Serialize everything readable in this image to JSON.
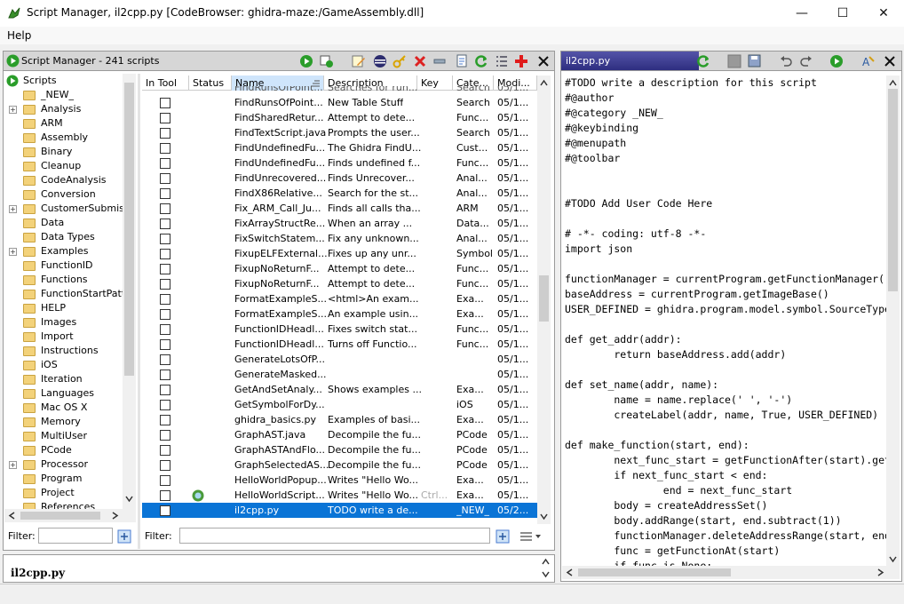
{
  "window": {
    "title": "Script Manager, il2cpp.py [CodeBrowser: ghidra-maze:/GameAssembly.dll]",
    "minimize": "—",
    "maximize": "☐",
    "close": "✕"
  },
  "menu": {
    "help": "Help"
  },
  "script_manager": {
    "header": "Script Manager - 241 scripts",
    "tree_root": "Scripts",
    "tree": [
      {
        "label": "_NEW_",
        "expandable": false
      },
      {
        "label": "Analysis",
        "expandable": true
      },
      {
        "label": "ARM",
        "expandable": false
      },
      {
        "label": "Assembly",
        "expandable": false
      },
      {
        "label": "Binary",
        "expandable": false
      },
      {
        "label": "Cleanup",
        "expandable": false
      },
      {
        "label": "CodeAnalysis",
        "expandable": false
      },
      {
        "label": "Conversion",
        "expandable": false
      },
      {
        "label": "CustomerSubmissio",
        "expandable": true
      },
      {
        "label": "Data",
        "expandable": false
      },
      {
        "label": "Data Types",
        "expandable": false
      },
      {
        "label": "Examples",
        "expandable": true
      },
      {
        "label": "FunctionID",
        "expandable": false
      },
      {
        "label": "Functions",
        "expandable": false
      },
      {
        "label": "FunctionStartPatte",
        "expandable": false
      },
      {
        "label": "HELP",
        "expandable": false
      },
      {
        "label": "Images",
        "expandable": false
      },
      {
        "label": "Import",
        "expandable": false
      },
      {
        "label": "Instructions",
        "expandable": false
      },
      {
        "label": "iOS",
        "expandable": false
      },
      {
        "label": "Iteration",
        "expandable": false
      },
      {
        "label": "Languages",
        "expandable": false
      },
      {
        "label": "Mac OS X",
        "expandable": false
      },
      {
        "label": "Memory",
        "expandable": false
      },
      {
        "label": "MultiUser",
        "expandable": false
      },
      {
        "label": "PCode",
        "expandable": false
      },
      {
        "label": "Processor",
        "expandable": true
      },
      {
        "label": "Program",
        "expandable": false
      },
      {
        "label": "Project",
        "expandable": false
      },
      {
        "label": "References",
        "expandable": false
      }
    ],
    "columns": {
      "in_tool": "In Tool",
      "status": "Status",
      "name": "Name",
      "description": "Description",
      "key": "Key",
      "category": "Cate...",
      "modified": "Modi..."
    },
    "partial_row": {
      "name": "FindRunsOfPoint...",
      "description": "Searches for run...",
      "category": "Search",
      "modified": "05/1..."
    },
    "rows": [
      {
        "name": "FindRunsOfPoint...",
        "description": "New Table Stuff",
        "key": "",
        "category": "Search",
        "modified": "05/1..."
      },
      {
        "name": "FindSharedRetur...",
        "description": " Attempt to dete...",
        "key": "",
        "category": "Func...",
        "modified": "05/1..."
      },
      {
        "name": "FindTextScript.java",
        "description": "Prompts the user...",
        "key": "",
        "category": "Search",
        "modified": "05/1..."
      },
      {
        "name": "FindUndefinedFu...",
        "description": "The Ghidra FindU...",
        "key": "",
        "category": "Cust...",
        "modified": "05/1..."
      },
      {
        "name": "FindUndefinedFu...",
        "description": "Finds undefined f...",
        "key": "",
        "category": "Func...",
        "modified": "05/1..."
      },
      {
        "name": "FindUnrecovered...",
        "description": "Finds Unrecover...",
        "key": "",
        "category": "Anal...",
        "modified": "05/1..."
      },
      {
        "name": "FindX86Relative...",
        "description": "Search for the st...",
        "key": "",
        "category": "Anal...",
        "modified": "05/1..."
      },
      {
        "name": "Fix_ARM_Call_Ju...",
        "description": "Finds all calls tha...",
        "key": "",
        "category": "ARM",
        "modified": "05/1..."
      },
      {
        "name": "FixArrayStructRe...",
        "description": " When an array ...",
        "key": "",
        "category": "Data...",
        "modified": "05/1..."
      },
      {
        "name": "FixSwitchStatem...",
        "description": "Fix any unknown...",
        "key": "",
        "category": "Anal...",
        "modified": "05/1..."
      },
      {
        "name": "FixupELFExternal...",
        "description": "Fixes up any unr...",
        "key": "",
        "category": "Symbol",
        "modified": "05/1..."
      },
      {
        "name": "FixupNoReturnF...",
        "description": " Attempt to dete...",
        "key": "",
        "category": "Func...",
        "modified": "05/1..."
      },
      {
        "name": "FixupNoReturnF...",
        "description": " Attempt to dete...",
        "key": "",
        "category": "Func...",
        "modified": "05/1..."
      },
      {
        "name": "FormatExampleS...",
        "description": "<html>An exam...",
        "key": "",
        "category": "Exa...",
        "modified": "05/1..."
      },
      {
        "name": "FormatExampleS...",
        "description": "An example usin...",
        "key": "",
        "category": "Exa...",
        "modified": "05/1..."
      },
      {
        "name": "FunctionIDHeadl...",
        "description": "Fixes switch stat...",
        "key": "",
        "category": "Func...",
        "modified": "05/1..."
      },
      {
        "name": "FunctionIDHeadl...",
        "description": "Turns off Functio...",
        "key": "",
        "category": "Func...",
        "modified": "05/1..."
      },
      {
        "name": "GenerateLotsOfP...",
        "description": "",
        "key": "",
        "category": "",
        "modified": "05/1..."
      },
      {
        "name": "GenerateMasked...",
        "description": "",
        "key": "",
        "category": "",
        "modified": "05/1..."
      },
      {
        "name": "GetAndSetAnaly...",
        "description": "Shows examples ...",
        "key": "",
        "category": "Exa...",
        "modified": "05/1..."
      },
      {
        "name": "GetSymbolForDy...",
        "description": "",
        "key": "",
        "category": "iOS",
        "modified": "05/1..."
      },
      {
        "name": "ghidra_basics.py",
        "description": "Examples of basi...",
        "key": "",
        "category": "Exa...",
        "modified": "05/1..."
      },
      {
        "name": "GraphAST.java",
        "description": "Decompile the fu...",
        "key": "",
        "category": "PCode",
        "modified": "05/1..."
      },
      {
        "name": "GraphASTAndFlo...",
        "description": "Decompile the fu...",
        "key": "",
        "category": "PCode",
        "modified": "05/1..."
      },
      {
        "name": "GraphSelectedAS...",
        "description": "Decompile the fu...",
        "key": "",
        "category": "PCode",
        "modified": "05/1..."
      },
      {
        "name": "HelloWorldPopup...",
        "description": "Writes \"Hello Wo...",
        "key": "",
        "category": "Exa...",
        "modified": "05/1..."
      },
      {
        "name": "HelloWorldScript...",
        "description": "Writes \"Hello Wo...",
        "key": "Ctrl...",
        "category": "Exa...",
        "modified": "05/1...",
        "status_icon": true
      },
      {
        "name": "il2cpp.py",
        "description": "TODO write a de...",
        "key": "",
        "category": "_NEW_",
        "modified": "05/2...",
        "selected": true
      }
    ],
    "filter_label": "Filter:",
    "table_filter_label": "Filter:",
    "bottom_title": "il2cpp.py"
  },
  "editor": {
    "tab_title": "il2cpp.py",
    "lines": [
      "#TODO write a description for this script",
      "#@author",
      "#@category _NEW_",
      "#@keybinding",
      "#@menupath",
      "#@toolbar",
      "",
      "",
      "#TODO Add User Code Here",
      "",
      "# -*- coding: utf-8 -*-",
      "import json",
      "",
      "functionManager = currentProgram.getFunctionManager()",
      "baseAddress = currentProgram.getImageBase()",
      "USER_DEFINED = ghidra.program.model.symbol.SourceType.USER_DEFINED",
      "",
      "def get_addr(addr):",
      "        return baseAddress.add(addr)",
      "",
      "def set_name(addr, name):",
      "        name = name.replace(' ', '-')",
      "        createLabel(addr, name, True, USER_DEFINED)",
      "",
      "def make_function(start, end):",
      "        next_func_start = getFunctionAfter(start).getEntryPoint()",
      "        if next_func_start < end:",
      "                end = next_func_start",
      "        body = createAddressSet()",
      "        body.addRange(start, end.subtract(1))",
      "        functionManager.deleteAddressRange(start, end)",
      "        func = getFunctionAt(start)",
      "        if func is None:"
    ]
  },
  "colors": {
    "selection": "#0a74d6",
    "header_bar": "#d6d6d6",
    "editor_tab": "#3c3c8c",
    "folder": "#f3d27a"
  }
}
